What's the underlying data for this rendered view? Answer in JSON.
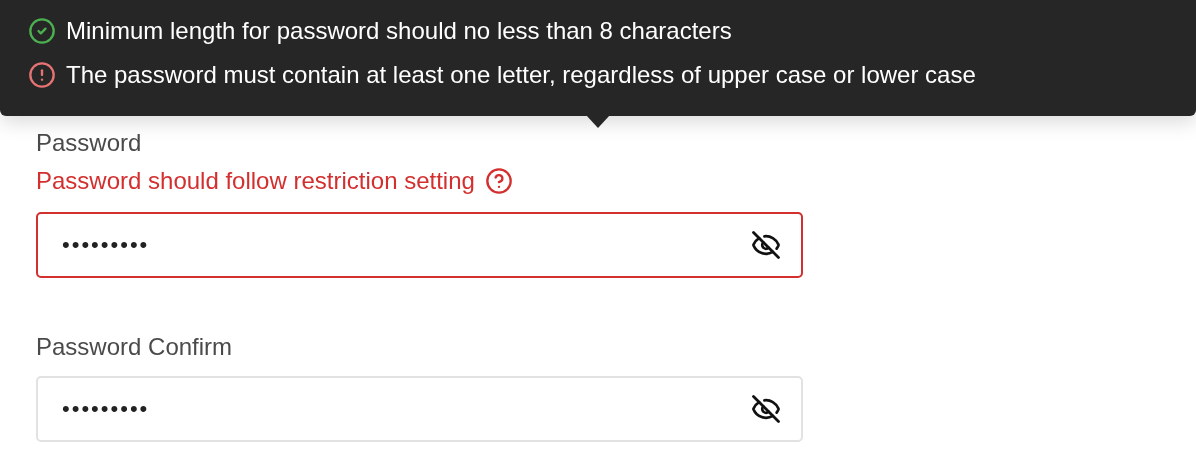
{
  "tooltip": {
    "rules": [
      {
        "text": "Minimum length for password should no less than 8 characters",
        "met": true
      },
      {
        "text": "The password must contain at least one letter, regardless of upper case or lower case",
        "met": false
      }
    ]
  },
  "fields": [
    {
      "label": "Password",
      "error": true,
      "message": "Password should follow restriction setting",
      "value": "•••••••••"
    },
    {
      "label": "Password Confirm",
      "error": false,
      "value": "•••••••••"
    }
  ]
}
